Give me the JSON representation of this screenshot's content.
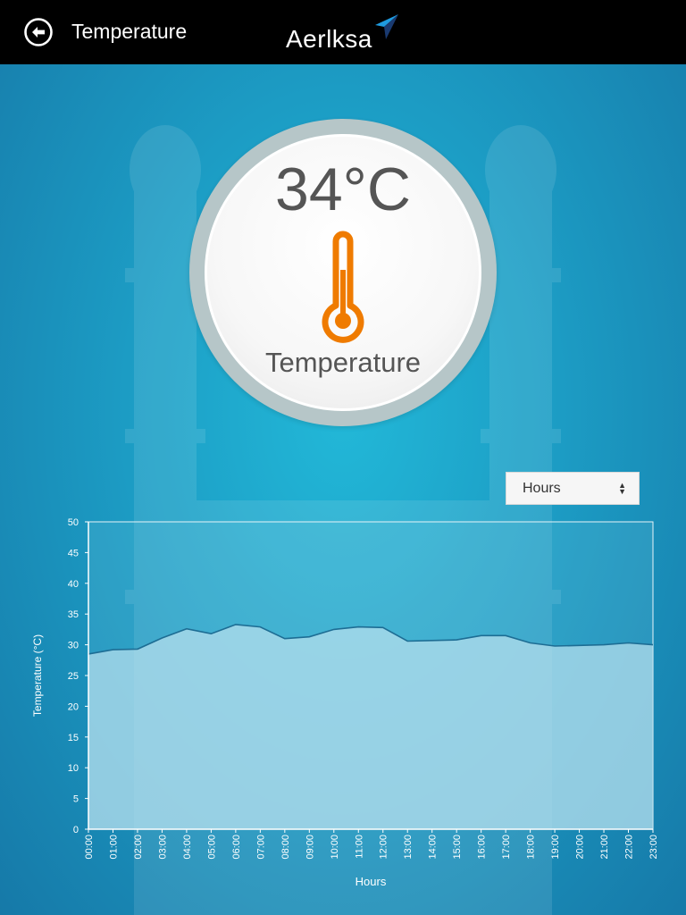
{
  "header": {
    "title": "Temperature",
    "logo_text": "Aerlksa",
    "icons": {
      "back": "back-arrow-icon",
      "logo_mark": "paper-plane-icon"
    }
  },
  "gauge": {
    "value": "34°C",
    "label": "Temperature",
    "icon": "thermometer-icon",
    "icon_color": "#ef7b00"
  },
  "period_select": {
    "selected": "Hours"
  },
  "chart_data": {
    "type": "area",
    "xlabel": "Hours",
    "ylabel": "Temperature (°C)",
    "ylim": [
      0,
      50
    ],
    "yticks": [
      0,
      5,
      10,
      15,
      20,
      25,
      30,
      35,
      40,
      45,
      50
    ],
    "categories": [
      "00:00",
      "01:00",
      "02:00",
      "03:00",
      "04:00",
      "05:00",
      "06:00",
      "07:00",
      "08:00",
      "09:00",
      "10:00",
      "11:00",
      "12:00",
      "13:00",
      "14:00",
      "15:00",
      "16:00",
      "17:00",
      "18:00",
      "19:00",
      "20:00",
      "21:00",
      "22:00",
      "23:00"
    ],
    "series": [
      {
        "values": [
          28.5,
          29.2,
          29.3,
          31.1,
          32.6,
          31.8,
          33.3,
          32.9,
          31.0,
          31.3,
          32.5,
          32.9,
          32.8,
          30.6,
          30.7,
          30.8,
          31.5,
          31.5,
          30.3,
          29.8,
          29.9,
          30.0,
          30.3,
          30.0
        ]
      }
    ],
    "grid": false
  }
}
